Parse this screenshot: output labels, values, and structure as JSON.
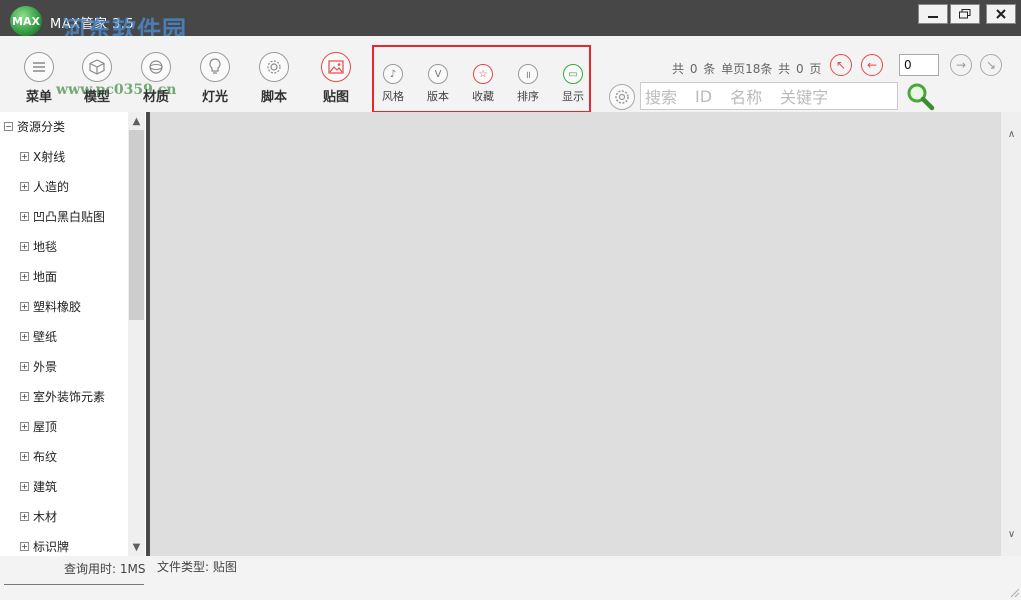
{
  "window": {
    "logo_text": "MAX",
    "title": "MAX管家 3.5",
    "watermark_main": "河东软件园",
    "watermark_url": "www.pc0359.cn"
  },
  "toolbar": {
    "main_tools": [
      {
        "label": "菜单",
        "icon": "menu-icon"
      },
      {
        "label": "模型",
        "icon": "cube-icon"
      },
      {
        "label": "材质",
        "icon": "sphere-icon"
      },
      {
        "label": "灯光",
        "icon": "bulb-icon"
      },
      {
        "label": "脚本",
        "icon": "gear-icon"
      },
      {
        "label": "贴图",
        "icon": "image-icon"
      }
    ],
    "small_tools": [
      {
        "label": "风格",
        "icon": "note-icon",
        "glyph": "♪"
      },
      {
        "label": "版本",
        "icon": "v-icon",
        "glyph": "V"
      },
      {
        "label": "收藏",
        "icon": "star-icon",
        "glyph": "☆"
      },
      {
        "label": "排序",
        "icon": "pause-icon",
        "glyph": "॥"
      },
      {
        "label": "显示",
        "icon": "monitor-icon",
        "glyph": "▭"
      }
    ]
  },
  "paging": {
    "info": "共 0 条  单页18条  共 0 页",
    "page_value": "0"
  },
  "search": {
    "placeholder_parts": [
      "搜索",
      "ID",
      "名称",
      "关键字"
    ]
  },
  "tree": {
    "root": "资源分类",
    "items": [
      "X射线",
      "人造的",
      "凹凸黑白贴图",
      "地毯",
      "地面",
      "塑料橡胶",
      "壁纸",
      "外景",
      "室外装饰元素",
      "屋顶",
      "布纹",
      "建筑",
      "木材",
      "标识牌"
    ]
  },
  "status": {
    "query_time": "查询用时: 1MS",
    "file_type": "文件类型: 贴图"
  },
  "colors": {
    "accent_red": "#e8262c",
    "title_bar": "#474747",
    "content_bg": "#dedede"
  }
}
